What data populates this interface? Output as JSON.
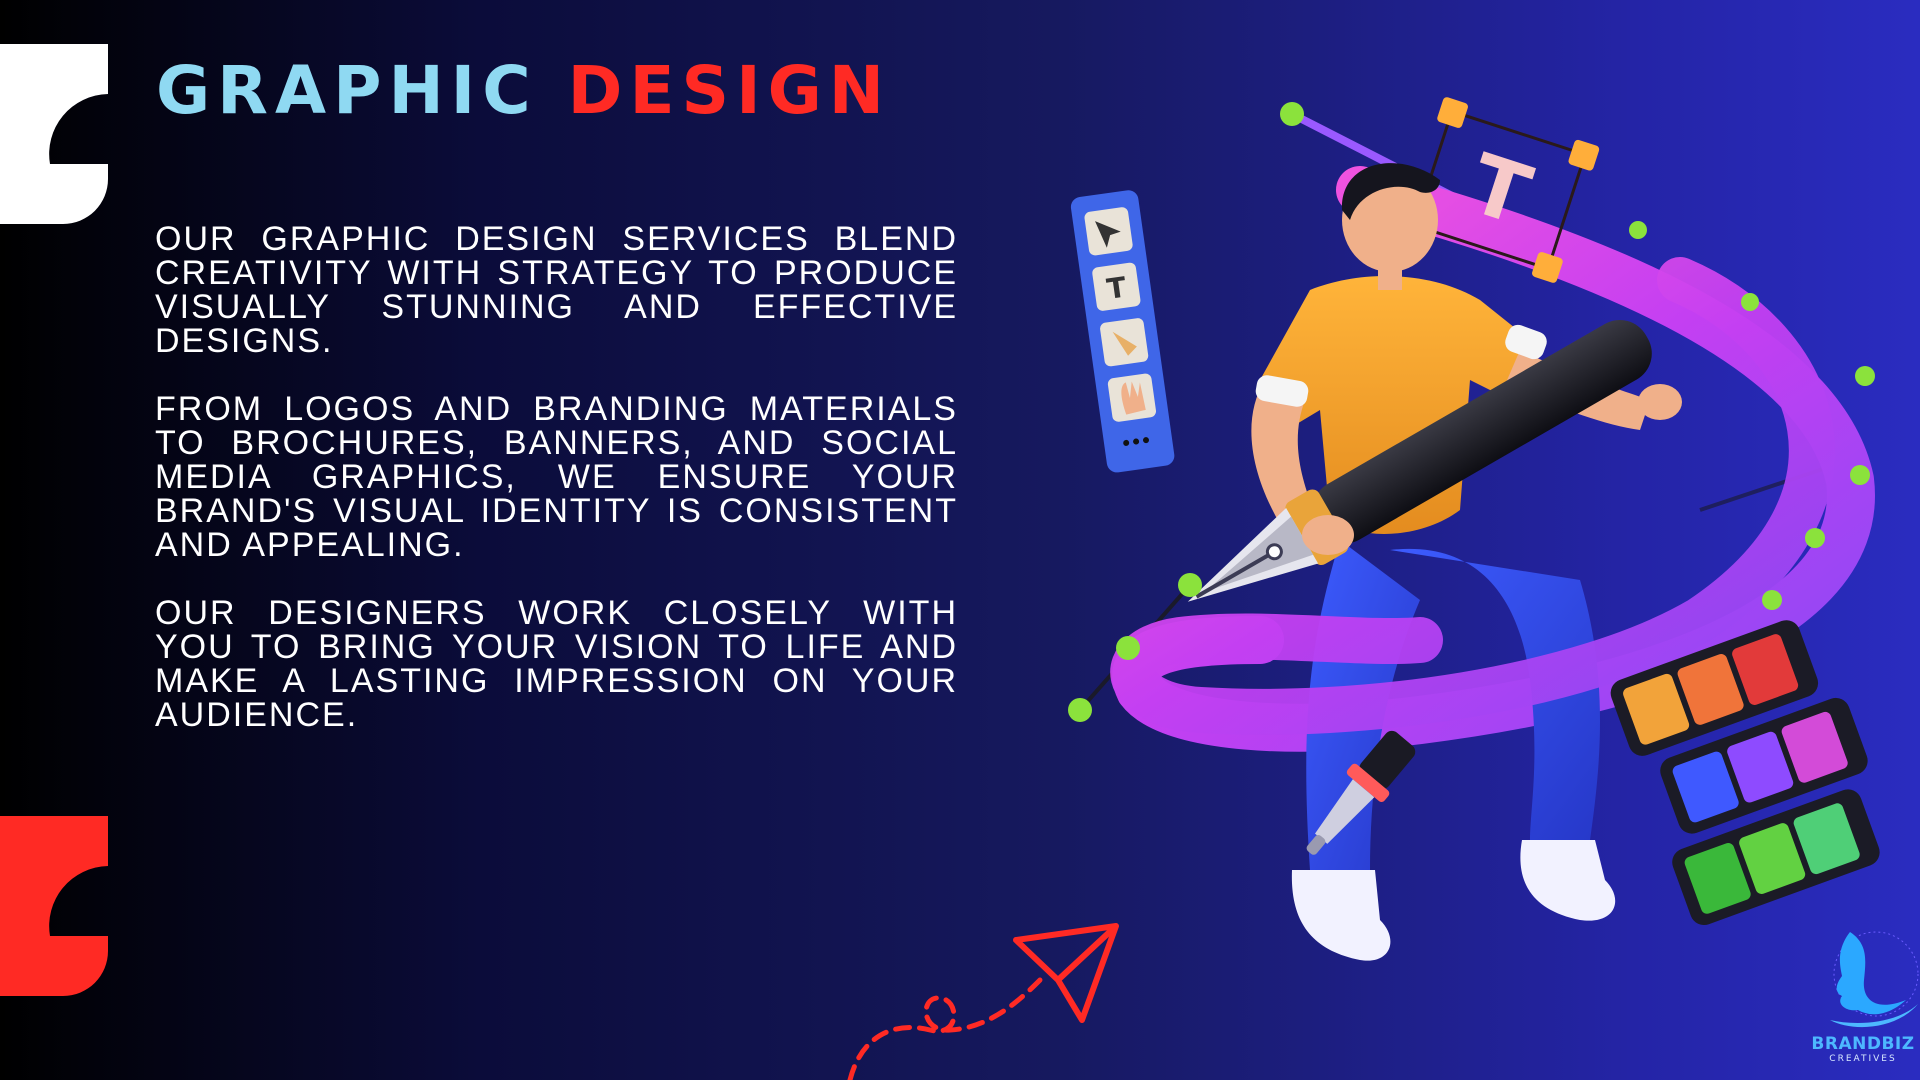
{
  "title": {
    "part1": "GRAPHIC",
    "part2": "DESIGN"
  },
  "paragraphs": [
    "Our graphic design services blend creativity with strategy to produce visually stunning and effective designs.",
    "From logos and branding materials to brochures, banners, and social media graphics, we ensure your brand's visual identity is consistent and appealing.",
    "Our designers work closely with you to bring your vision to life and make a lasting impression on your audience."
  ],
  "logo": {
    "name": "BRANDBIZ",
    "subtitle": "CREATIVES"
  },
  "colors": {
    "title_light": "#8fd9f2",
    "title_accent": "#ff2a24",
    "background_left": "#000000",
    "background_right": "#2a2cc0",
    "logo_blue": "#4db8ff"
  },
  "illustration": {
    "subject": "designer-with-pen-tool",
    "icons": [
      "cursor-icon",
      "text-tool-icon",
      "pen-nib-icon",
      "hand-icon",
      "more-icon"
    ]
  }
}
